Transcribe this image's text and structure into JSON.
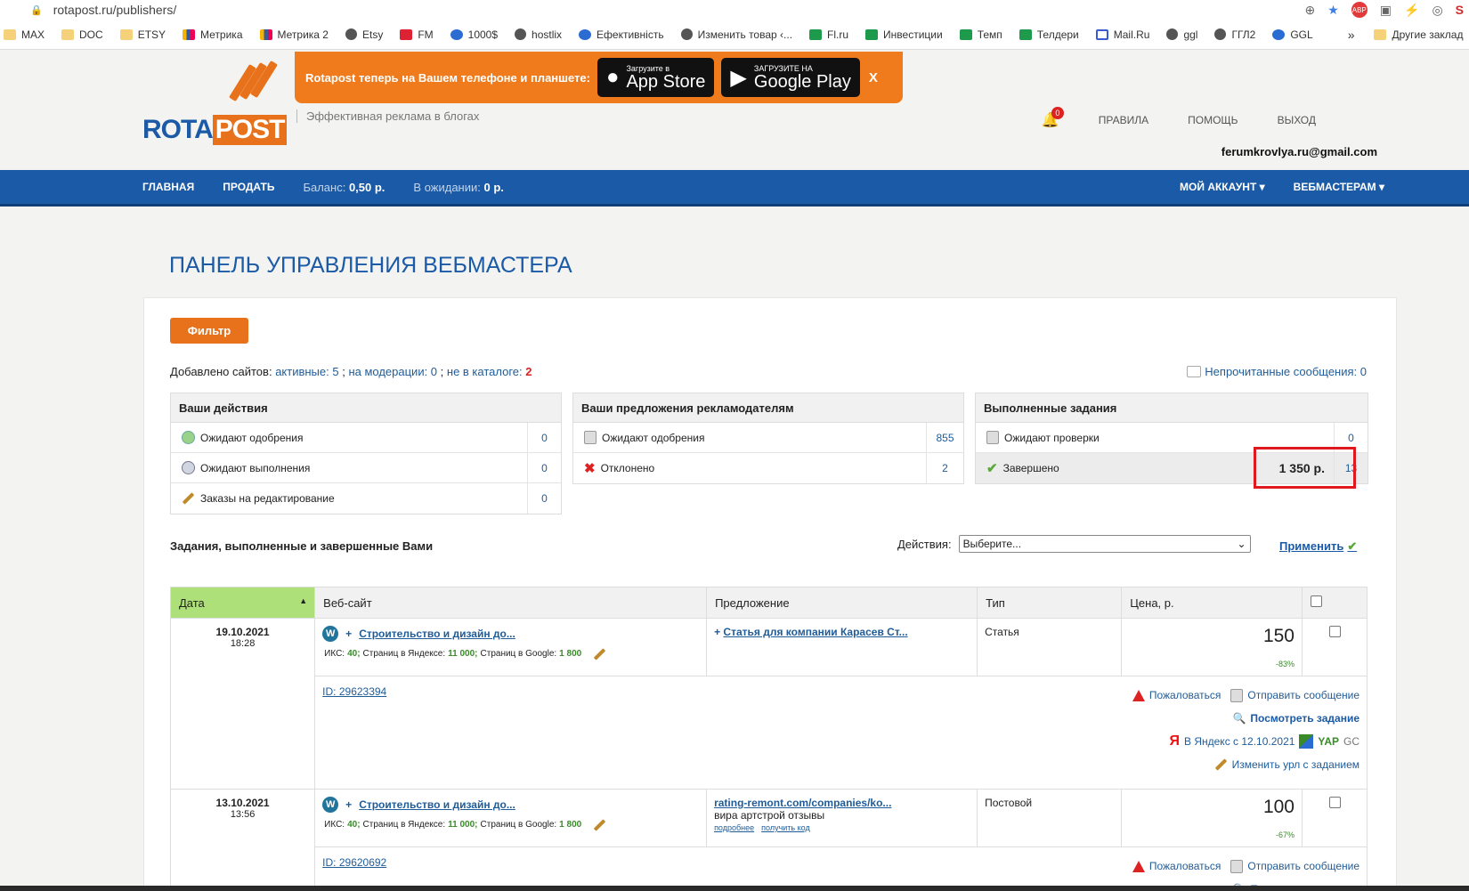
{
  "browser": {
    "url": "rotapost.ru/publishers/",
    "bookmarks": [
      "MAX",
      "DOC",
      "ETSY",
      "Метрика",
      "Метрика 2",
      "Etsy",
      "FM",
      "1000$",
      "hostlix",
      "Ефективність",
      "Изменить товар ‹...",
      "Fl.ru",
      "Инвестиции",
      "Темп",
      "Телдери",
      "Mail.Ru",
      "ggl",
      "ГГЛ2",
      "GGL"
    ],
    "more": "»",
    "other_bookmarks": "Другие заклад"
  },
  "header": {
    "logo_rota": "ROTA",
    "logo_post": "POST",
    "tagline": "Эффективная реклама в блогах",
    "promo_text": "Rotapost теперь на Вашем телефоне и планшете:",
    "appstore_small": "Загрузите в",
    "appstore_big": "App Store",
    "gplay_small": "ЗАГРУЗИТЕ НА",
    "gplay_big": "Google Play",
    "promo_close": "X",
    "notif_count": "0",
    "rules": "ПРАВИЛА",
    "help": "ПОМОЩЬ",
    "logout": "ВЫХОД",
    "email": "ferumkrovlya.ru@gmail.com"
  },
  "nav": {
    "home": "ГЛАВНАЯ",
    "sell": "ПРОДАТЬ",
    "balance_label": "Баланс:",
    "balance_value": "0,50 р.",
    "pending_label": "В ожидании:",
    "pending_value": "0 р.",
    "account": "МОЙ АККАУНТ ▾",
    "webmasters": "ВЕБМАСТЕРАМ ▾"
  },
  "main": {
    "title": "ПАНЕЛЬ УПРАВЛЕНИЯ ВЕБМАСТЕРА",
    "filter": "Фильтр",
    "sites_label": "Добавлено сайтов:",
    "active": "активные: 5",
    "moderation": "на модерации: 0",
    "not_catalog_label": "не в каталоге:",
    "not_catalog_value": "2",
    "unread": "Непрочитанные сообщения: 0"
  },
  "boxes": {
    "actions": {
      "title": "Ваши действия",
      "rows": [
        {
          "label": "Ожидают одобрения",
          "count": "0"
        },
        {
          "label": "Ожидают выполнения",
          "count": "0"
        },
        {
          "label": "Заказы на редактирование",
          "count": "0"
        }
      ]
    },
    "offers": {
      "title": "Ваши предложения рекламодателям",
      "rows": [
        {
          "label": "Ожидают одобрения",
          "count": "855"
        },
        {
          "label": "Отклонено",
          "count": "2"
        }
      ]
    },
    "completed": {
      "title": "Выполненные задания",
      "rows": [
        {
          "label": "Ожидают проверки",
          "count": "0"
        },
        {
          "label": "Завершено",
          "amount": "1 350 р.",
          "count": "13"
        }
      ]
    }
  },
  "tasks": {
    "title": "Задания, выполненные и завершенные Вами",
    "actions_label": "Действия:",
    "select_value": "Выберите...",
    "apply": "Применить",
    "columns": [
      "Дата",
      "Веб-сайт",
      "Предложение",
      "Тип",
      "Цена, р."
    ],
    "rows": [
      {
        "date": "19.10.2021",
        "time": "18:28",
        "site": "Строительство и дизайн до...",
        "iks_label": "ИКС:",
        "iks": "40;",
        "yandex_label": "Страниц в Яндексе:",
        "yandex": "11 000;",
        "google_label": "Страниц в Google:",
        "google": "1 800",
        "offer": "Статья для компании Карасев Ст...",
        "type": "Статья",
        "price": "150",
        "pct": "-83%",
        "id": "ID: 29623394",
        "complain": "Пожаловаться",
        "message": "Отправить сообщение",
        "view": "Посмотреть задание",
        "yandex_since": "В Яндекс с 12.10.2021",
        "yap": "YAP",
        "gc": "GC",
        "edit_url": "Изменить урл с заданием"
      },
      {
        "date": "13.10.2021",
        "time": "13:56",
        "site": "Строительство и дизайн до...",
        "iks_label": "ИКС:",
        "iks": "40;",
        "yandex_label": "Страниц в Яндексе:",
        "yandex": "11 000;",
        "google_label": "Страниц в Google:",
        "google": "1 800",
        "offer": "rating-remont.com/companies/ko...",
        "offer_sub": "вира артстрой отзывы",
        "more": "подробнее",
        "get_code": "получить код",
        "type": "Постовой",
        "price": "100",
        "pct": "-67%",
        "id": "ID: 29620692",
        "complain": "Пожаловаться",
        "message": "Отправить сообщение",
        "view": "Посмотреть задание"
      }
    ]
  }
}
